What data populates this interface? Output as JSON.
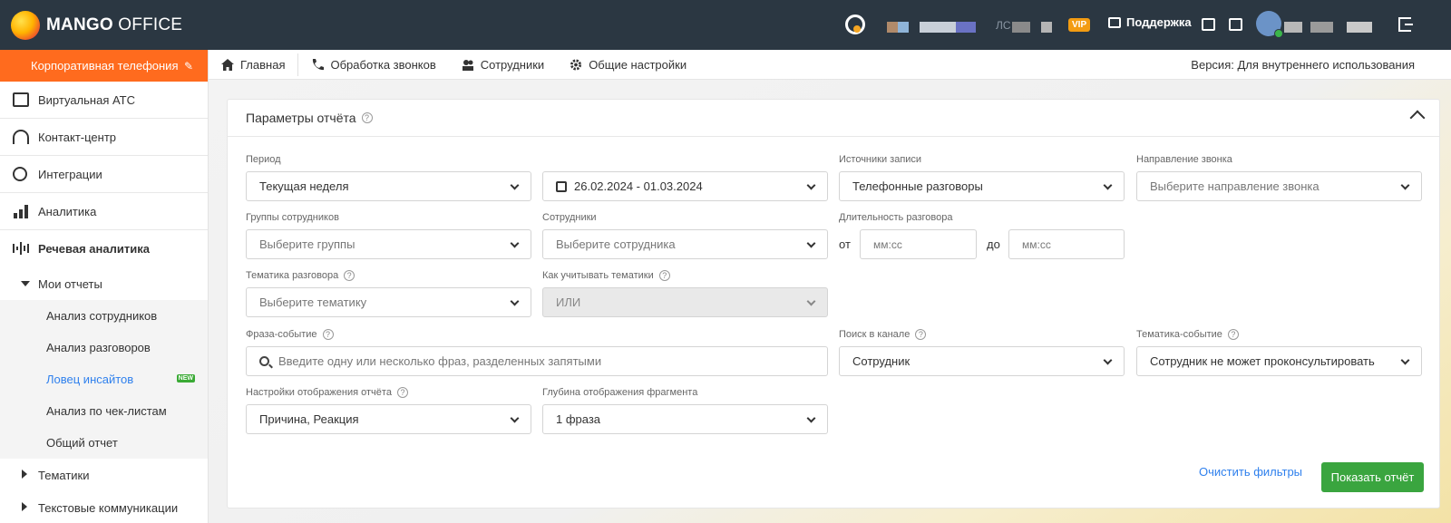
{
  "app": {
    "logo_bold": "MANGO",
    "logo_light": " OFFICE"
  },
  "topbar": {
    "account_prefix": "ЛС",
    "vip_badge": "VIP",
    "support_label": "Поддержка"
  },
  "sidebar": {
    "header_label": "Корпоративная телефония",
    "items": [
      {
        "label": "Виртуальная АТС",
        "icon": "fax-icon"
      },
      {
        "label": "Контакт-центр",
        "icon": "headset-icon"
      },
      {
        "label": "Интеграции",
        "icon": "integrations-icon"
      },
      {
        "label": "Аналитика",
        "icon": "bar-chart-icon"
      },
      {
        "label": "Речевая аналитика",
        "icon": "waveform-icon"
      }
    ],
    "my_reports": "Мои отчеты",
    "reports": [
      {
        "label": "Анализ сотрудников"
      },
      {
        "label": "Анализ разговоров"
      },
      {
        "label": "Ловец инсайтов",
        "badge": "NEW"
      },
      {
        "label": "Анализ по чек-листам"
      },
      {
        "label": "Общий отчет"
      }
    ],
    "themes": "Тематики",
    "text_comms": "Текстовые коммуникации"
  },
  "subnav": {
    "items": [
      {
        "label": "Главная",
        "icon": "home-icon"
      },
      {
        "label": "Обработка звонков",
        "icon": "phone-icon"
      },
      {
        "label": "Сотрудники",
        "icon": "users-icon"
      },
      {
        "label": "Общие настройки",
        "icon": "gear-icon"
      }
    ],
    "version": "Версия: Для внутреннего использования"
  },
  "card": {
    "title": "Параметры отчёта",
    "fields": {
      "period_label": "Период",
      "period_value": "Текущая неделя",
      "date_range": "26.02.2024 - 01.03.2024",
      "sources_label": "Источники записи",
      "sources_value": "Телефонные разговоры",
      "direction_label": "Направление звонка",
      "direction_placeholder": "Выберите направление звонка",
      "groups_label": "Группы сотрудников",
      "groups_placeholder": "Выберите группы",
      "employees_label": "Сотрудники",
      "employees_placeholder": "Выберите сотрудника",
      "duration_label": "Длительность разговора",
      "from_label": "от",
      "to_label": "до",
      "from_placeholder": "мм:сс",
      "to_placeholder": "мм:сс",
      "topic_label": "Тематика разговора",
      "topic_placeholder": "Выберите тематику",
      "topic_mode_label": "Как учитывать тематики",
      "topic_mode_value": "ИЛИ",
      "phrase_label": "Фраза-событие",
      "phrase_placeholder": "Введите одну или несколько фраз, разделенных запятыми",
      "channel_label": "Поиск в канале",
      "channel_value": "Сотрудник",
      "topic_event_label": "Тематика-событие",
      "topic_event_value": "Сотрудник не может проконсультировать",
      "display_label": "Настройки отображения отчёта",
      "display_value": "Причина, Реакция",
      "depth_label": "Глубина отображения фрагмента",
      "depth_value": "1 фраза"
    },
    "clear_label": "Очистить фильтры",
    "show_label": "Показать отчёт"
  },
  "colors": {
    "topbar": "#2b3742",
    "accent_orange": "#ff6b1e",
    "primary_green": "#3aa53f",
    "link_blue": "#2f80ed"
  }
}
